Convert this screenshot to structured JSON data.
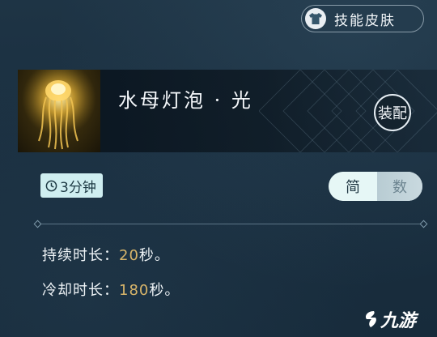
{
  "top_button": {
    "label": "技能皮肤",
    "icon": "shirt-icon"
  },
  "skin": {
    "name": "水母灯泡 · 光",
    "thumbnail": "jellyfish-lantern-image"
  },
  "equip_button": {
    "label": "装配"
  },
  "duration": {
    "label": "3分钟",
    "icon": "clock-icon"
  },
  "view_toggle": {
    "options": [
      "简",
      "数"
    ],
    "selected": "简"
  },
  "stats": {
    "duration_label": "持续时长：",
    "duration_value": "20",
    "duration_unit": "秒。",
    "cooldown_label": "冷却时长：",
    "cooldown_value": "180",
    "cooldown_unit": "秒。"
  },
  "watermark": {
    "text": "九游"
  },
  "colors": {
    "accent_value": "#d8b56a",
    "badge_bg": "#cfeef0",
    "panel_bg": "#1a2f40"
  }
}
